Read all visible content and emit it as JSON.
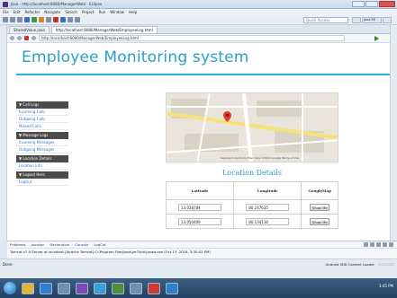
{
  "window": {
    "title": "Java - http://localhost:8080/ManagerWeb/ - Eclipse"
  },
  "menu": [
    "File",
    "Edit",
    "Refactor",
    "Navigate",
    "Search",
    "Project",
    "Run",
    "Window",
    "Help"
  ],
  "toolbar": {
    "quick_access_placeholder": "Quick Access",
    "perspective_label": "Java EE"
  },
  "editor_tabs": [
    {
      "label": "SharedValue.java"
    },
    {
      "label": "http://localhost:8080/ManagerWeb/EmployeeLog.html"
    }
  ],
  "browser": {
    "url": "http://localhost:8080/ManagerWeb/EmployeeLog.html"
  },
  "page": {
    "title": "Employee Monitoring system",
    "sidebar": {
      "call_logs_header": "▼ Call Logs",
      "incoming_calls": "Incoming Calls",
      "outgoing_calls": "Outgoing Calls",
      "missed_calls": "Missed Calls",
      "message_logs_header": "▼ Message Logs",
      "incoming_messages": "Incoming Messages",
      "outgoing_messages": "Outgoing Messages",
      "location_header": "▼ Location Details",
      "location_info": "Location Info",
      "logout_header": "▼ Logout Here",
      "logout": "LogOut"
    },
    "map": {
      "attribution": "Keyboard shortcuts  Map data ©2016 Google  Terms of Use"
    },
    "location_title": "Location Details",
    "table": {
      "headers": [
        "Latitude",
        "Longitude",
        "GoogleMap"
      ],
      "rows": [
        {
          "lat": "13.028784",
          "lng": "80.247635",
          "btn": "Show Me"
        },
        {
          "lat": "13.050409",
          "lng": "80.134136",
          "btn": "Show Me"
        }
      ]
    }
  },
  "console": {
    "tabs": [
      "Problems",
      "Javadoc",
      "Declaration",
      "Console",
      "LogCat"
    ],
    "line": "Tomcat v7.0 Server at localhost [Apache Tomcat] C:\\Program Files\\Java\\jre7\\bin\\javaw.exe (Oct 13, 2016, 3:30:02 PM)"
  },
  "status": {
    "left": "Done",
    "loader": "Android SDK Content Loader"
  },
  "tray": {
    "time": "3:45 PM"
  }
}
